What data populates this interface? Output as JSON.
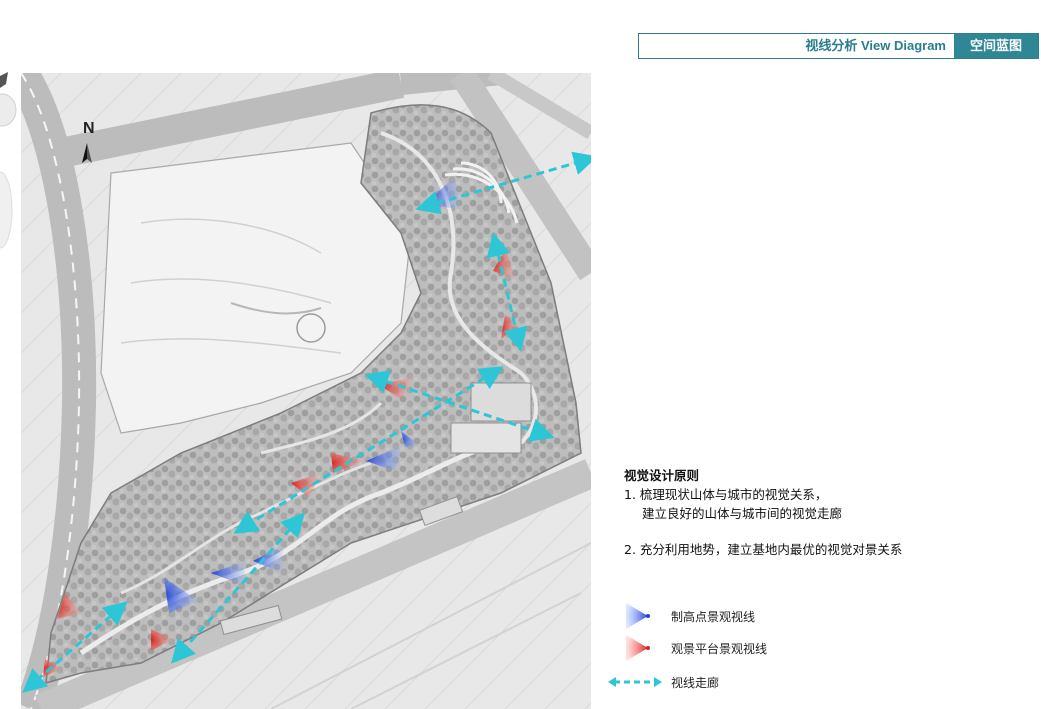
{
  "header": {
    "title": "视线分析 View Diagram",
    "tab": "空间蓝图"
  },
  "map": {
    "north_label": "N"
  },
  "principles": {
    "title": "视觉设计原则",
    "item1_line1": "1. 梳理现状山体与城市的视觉关系，",
    "item1_line2": "建立良好的山体与城市间的视觉走廊",
    "item2": "2. 充分利用地势，建立基地内最优的视觉对景关系"
  },
  "legend": {
    "items": [
      {
        "label": "制高点景观视线",
        "color": "#2f5fe0",
        "icon": "blue-cone-icon"
      },
      {
        "label": "观景平台景观视线",
        "color": "#e23b35",
        "icon": "red-cone-icon"
      },
      {
        "label": "视线走廊",
        "color": "#2cc6d6",
        "icon": "dashed-double-arrow-icon"
      }
    ]
  },
  "colors": {
    "accent": "#2f8795",
    "corridor": "#2cc6d6",
    "highpoint": "#2f5fe0",
    "platform": "#e23b35"
  }
}
